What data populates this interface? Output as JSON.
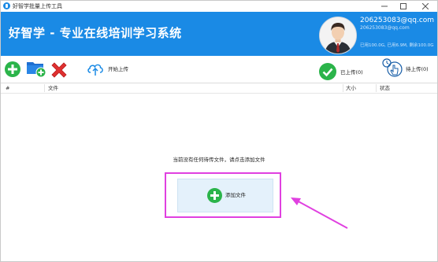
{
  "titlebar": {
    "title": "好智学批量上传工具",
    "icons": {
      "app": "app-logo-icon",
      "minimize": "minimize-icon",
      "maximize": "maximize-icon",
      "close": "close-icon"
    }
  },
  "header": {
    "brand": "好智学 - 专业在线培训学习系统",
    "user": {
      "email": "206253083@qq.com",
      "email_sub": "206253083@qq.com",
      "quota": "已用100.0G, 已用6.9M, 剩余100.0G"
    },
    "colors": {
      "header_bg": "#1a8ae5"
    }
  },
  "toolbar": {
    "add_icon": "add-circle-icon",
    "folder_add_icon": "folder-add-icon",
    "delete_icon": "delete-x-icon",
    "start_upload_label": "开始上传",
    "start_upload_icon": "cloud-upload-icon",
    "uploaded_label": "已上传(0)",
    "uploaded_icon": "check-circle-icon",
    "pending_label": "待上传(0)",
    "pending_icon": "clock-hand-icon"
  },
  "table": {
    "columns": [
      "#",
      "文件",
      "大小",
      "状态"
    ]
  },
  "empty_state": {
    "message": "当前没有任何待传文件，请点击添加文件",
    "add_button_label": "添加文件",
    "colors": {
      "highlight": "#e040e0",
      "button_bg": "#e4f1fb",
      "green": "#2bb44a"
    }
  }
}
